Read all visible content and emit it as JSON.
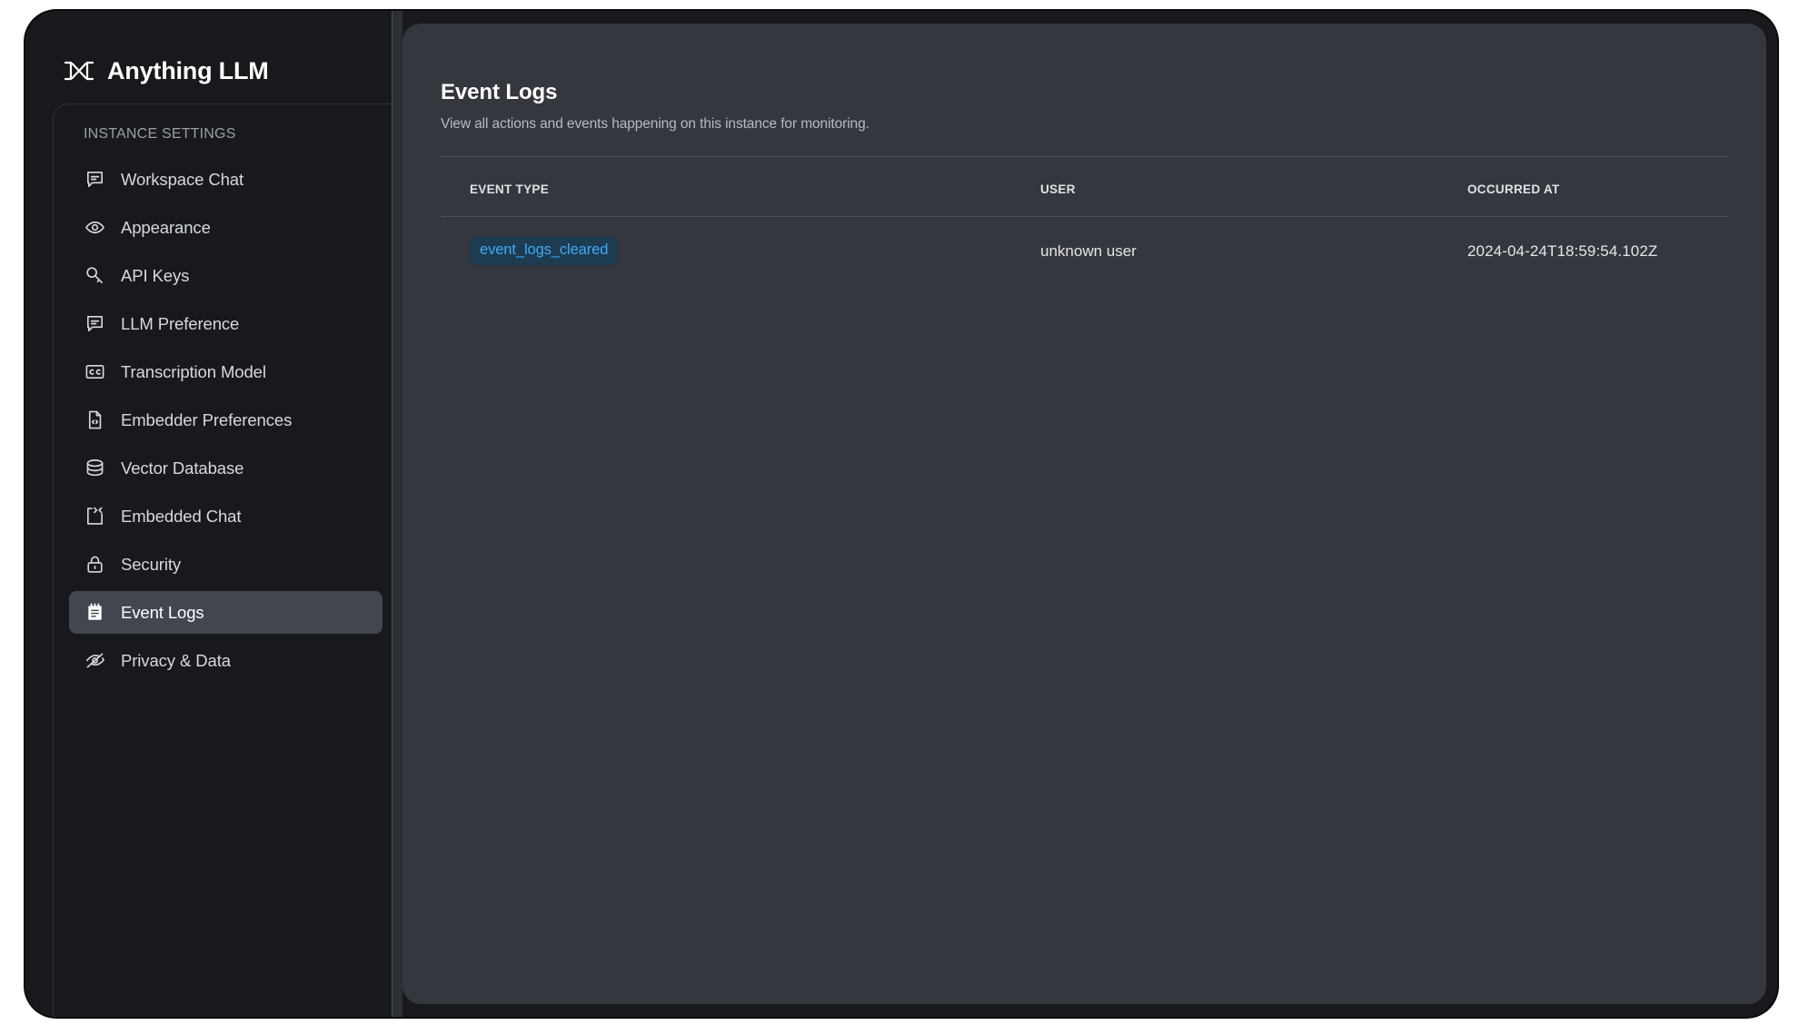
{
  "brand": {
    "name": "Anything LLM",
    "logo_icon": "anythingllm-logo-icon"
  },
  "sidebar": {
    "section_title": "INSTANCE SETTINGS",
    "items": [
      {
        "label": "Workspace Chat",
        "icon": "chat-bubble-icon",
        "active": false
      },
      {
        "label": "Appearance",
        "icon": "eye-icon",
        "active": false
      },
      {
        "label": "API Keys",
        "icon": "key-icon",
        "active": false
      },
      {
        "label": "LLM Preference",
        "icon": "chat-bubble-icon",
        "active": false
      },
      {
        "label": "Transcription Model",
        "icon": "closed-caption-icon",
        "active": false
      },
      {
        "label": "Embedder Preferences",
        "icon": "file-code-icon",
        "active": false
      },
      {
        "label": "Vector Database",
        "icon": "database-icon",
        "active": false
      },
      {
        "label": "Embedded Chat",
        "icon": "code-brackets-icon",
        "active": false
      },
      {
        "label": "Security",
        "icon": "lock-icon",
        "active": false
      },
      {
        "label": "Event Logs",
        "icon": "notepad-icon",
        "active": true
      },
      {
        "label": "Privacy & Data",
        "icon": "eye-slash-icon",
        "active": false
      }
    ]
  },
  "main": {
    "title": "Event Logs",
    "subtitle": "View all actions and events happening on this instance for monitoring.",
    "table": {
      "columns": [
        "EVENT TYPE",
        "USER",
        "OCCURRED AT"
      ],
      "rows": [
        {
          "event_type": "event_logs_cleared",
          "user": "unknown user",
          "occurred_at": "2024-04-24T18:59:54.102Z"
        }
      ]
    }
  },
  "colors": {
    "window_bg": "#17191c",
    "panel_bg": "#34373d",
    "active_item_bg": "#41464f",
    "badge_bg": "#1d3c52",
    "badge_text": "#3fa9f5",
    "divider": "#4b4f57"
  }
}
